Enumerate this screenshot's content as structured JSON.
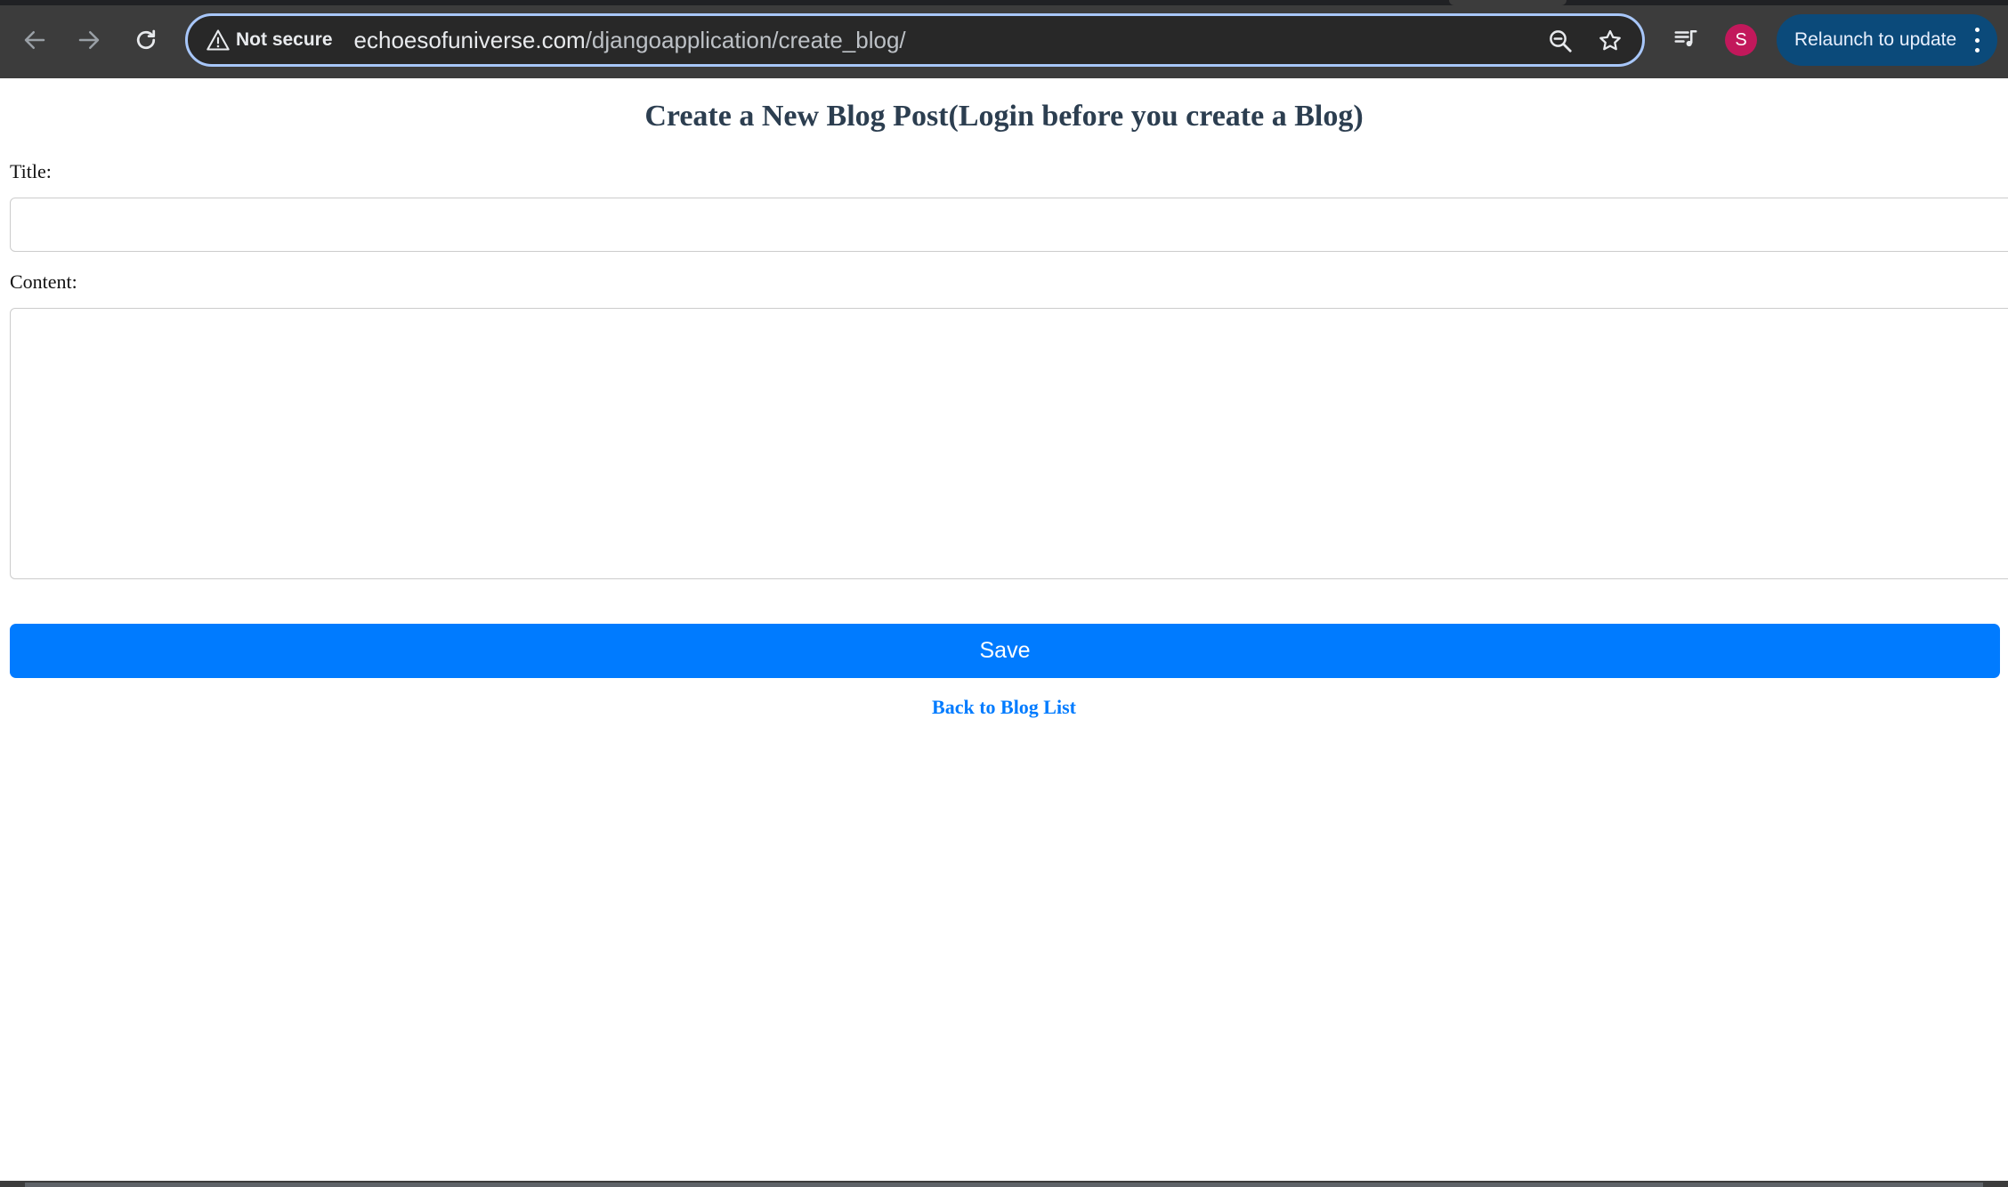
{
  "browser": {
    "security_label": "Not secure",
    "url_domain": "echoesofuniverse.com",
    "url_path": "/djangoapplication/create_blog/",
    "profile_initial": "S",
    "relaunch_label": "Relaunch to update",
    "colors": {
      "toolbar": "#3c3c3c",
      "omnibox_border": "#a8c7fa",
      "relaunch_bg": "#0b4a7a",
      "avatar_bg": "#c2185b"
    },
    "icons": [
      "back-arrow-icon",
      "forward-arrow-icon",
      "reload-icon",
      "warning-icon",
      "zoom-icon",
      "bookmark-star-icon",
      "media-controls-icon",
      "kebab-menu-icon"
    ]
  },
  "page": {
    "title": "Create a New Blog Post(Login before you create a Blog)",
    "form": {
      "title_label": "Title:",
      "title_value": "",
      "content_label": "Content:",
      "content_value": "",
      "save_label": "Save"
    },
    "back_link": "Back to Blog List",
    "colors": {
      "title_text": "#2c3e50",
      "primary": "#007bff"
    }
  }
}
